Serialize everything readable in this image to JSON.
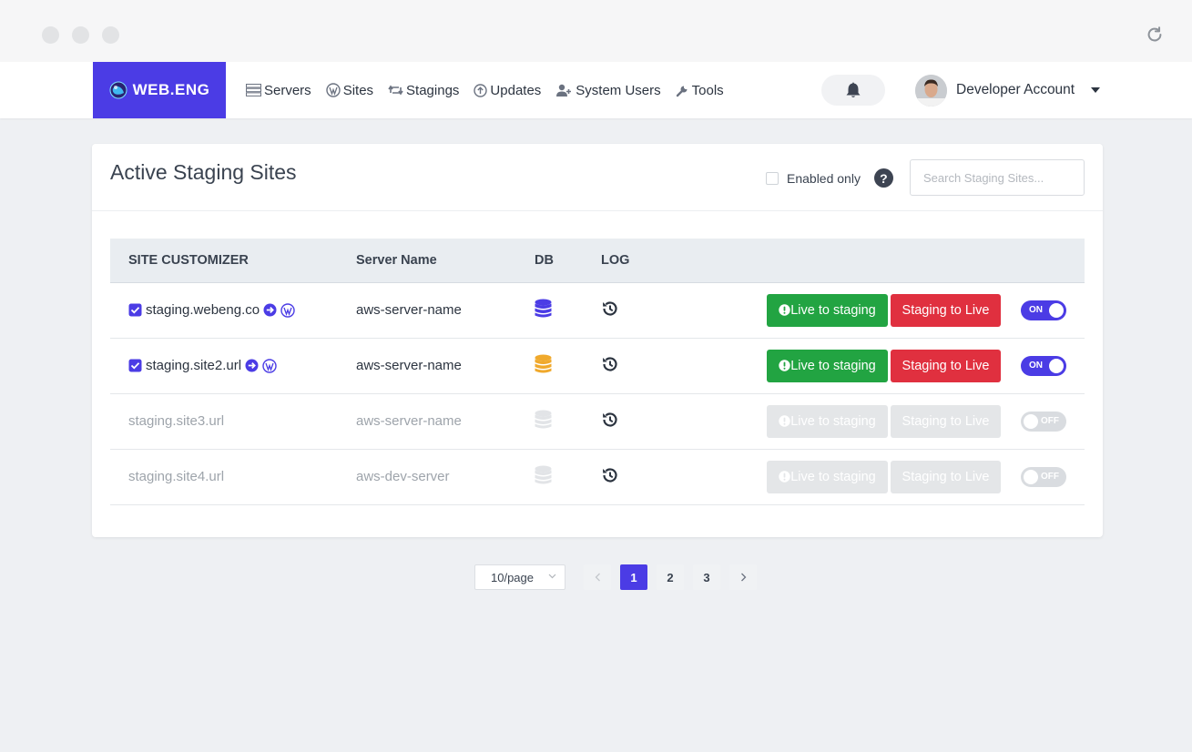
{
  "brand": {
    "name": "WEB.ENG",
    "color": "#4b3ce5"
  },
  "nav": [
    {
      "label": "Servers",
      "icon": "server-icon"
    },
    {
      "label": "Sites",
      "icon": "wordpress-icon"
    },
    {
      "label": "Stagings",
      "icon": "retweet-icon"
    },
    {
      "label": "Updates",
      "icon": "arrow-up-circle-icon"
    },
    {
      "label": "System Users",
      "icon": "users-icon"
    },
    {
      "label": "Tools",
      "icon": "wrench-icon"
    }
  ],
  "account": {
    "name": "Developer Account"
  },
  "card": {
    "title": "Active Staging Sites",
    "filter_label": "Enabled only",
    "help_glyph": "?",
    "search_placeholder": "Search Staging Sites..."
  },
  "table": {
    "headers": [
      "SITE CUSTOMIZER",
      "Server Name",
      "DB",
      "LOG"
    ],
    "rows": [
      {
        "site": "staging.webeng.co",
        "server": "aws-server-name",
        "enabled": true,
        "db_color": "#4b3ce5",
        "toggle": "ON",
        "btn_live_to_staging": "Live to staging",
        "btn_staging_to_live": "Staging to Live"
      },
      {
        "site": "staging.site2.url",
        "server": "aws-server-name",
        "enabled": true,
        "db_color": "#f0a92c",
        "toggle": "ON",
        "btn_live_to_staging": "Live to staging",
        "btn_staging_to_live": "Staging to Live"
      },
      {
        "site": "staging.site3.url",
        "server": "aws-server-name",
        "enabled": false,
        "db_color": "#e2e4e7",
        "toggle": "OFF",
        "btn_live_to_staging": "Live to staging",
        "btn_staging_to_live": "Staging to Live"
      },
      {
        "site": "staging.site4.url",
        "server": "aws-dev-server",
        "enabled": false,
        "db_color": "#e2e4e7",
        "toggle": "OFF",
        "btn_live_to_staging": "Live to staging",
        "btn_staging_to_live": "Staging to Live"
      }
    ]
  },
  "pagination": {
    "page_size": "10/page",
    "pages": [
      "1",
      "2",
      "3"
    ],
    "current": "1"
  },
  "colors": {
    "green": "#22a442",
    "red": "#e0303f",
    "accent": "#4b3ce5"
  }
}
